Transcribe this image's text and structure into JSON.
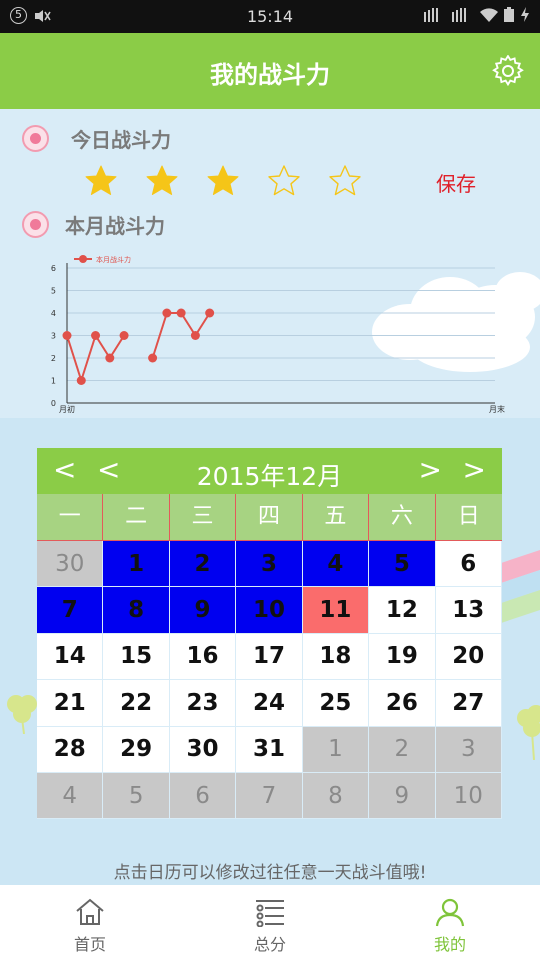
{
  "status_bar": {
    "time": "15:14",
    "badge": "5"
  },
  "header": {
    "title": "我的战斗力"
  },
  "today": {
    "title": "今日战斗力",
    "rating": 3,
    "max": 5,
    "save_label": "保存"
  },
  "month": {
    "title": "本月战斗力"
  },
  "chart_data": {
    "type": "line",
    "series": [
      {
        "name": "本月战斗力",
        "x": [
          1,
          2,
          3,
          4,
          5,
          7,
          8,
          9,
          10,
          11
        ],
        "values": [
          3,
          1,
          3,
          2,
          3,
          2,
          4,
          4,
          3,
          4
        ]
      }
    ],
    "ylim": [
      0,
      6
    ],
    "yticks": [
      "0",
      "1",
      "2",
      "3",
      "4",
      "5",
      "6"
    ],
    "xlabel_start": "月初",
    "xlabel_end": "月末",
    "legend": "top-left",
    "grid": true,
    "color": "#e0514a"
  },
  "calendar": {
    "title": "2015年12月",
    "prev_year": "<",
    "prev_month": "<",
    "next_month": ">",
    "next_year": ">",
    "weekdays": [
      "一",
      "二",
      "三",
      "四",
      "五",
      "六",
      "日"
    ],
    "days": [
      {
        "d": "30",
        "s": "other"
      },
      {
        "d": "1",
        "s": "blue"
      },
      {
        "d": "2",
        "s": "blue"
      },
      {
        "d": "3",
        "s": "blue"
      },
      {
        "d": "4",
        "s": "blue"
      },
      {
        "d": "5",
        "s": "blue"
      },
      {
        "d": "6",
        "s": "normal"
      },
      {
        "d": "7",
        "s": "blue"
      },
      {
        "d": "8",
        "s": "blue"
      },
      {
        "d": "9",
        "s": "blue"
      },
      {
        "d": "10",
        "s": "blue"
      },
      {
        "d": "11",
        "s": "today"
      },
      {
        "d": "12",
        "s": "normal"
      },
      {
        "d": "13",
        "s": "normal"
      },
      {
        "d": "14",
        "s": "normal"
      },
      {
        "d": "15",
        "s": "normal"
      },
      {
        "d": "16",
        "s": "normal"
      },
      {
        "d": "17",
        "s": "normal"
      },
      {
        "d": "18",
        "s": "normal"
      },
      {
        "d": "19",
        "s": "normal"
      },
      {
        "d": "20",
        "s": "normal"
      },
      {
        "d": "21",
        "s": "normal"
      },
      {
        "d": "22",
        "s": "normal"
      },
      {
        "d": "23",
        "s": "normal"
      },
      {
        "d": "24",
        "s": "normal"
      },
      {
        "d": "25",
        "s": "normal"
      },
      {
        "d": "26",
        "s": "normal"
      },
      {
        "d": "27",
        "s": "normal"
      },
      {
        "d": "28",
        "s": "normal"
      },
      {
        "d": "29",
        "s": "normal"
      },
      {
        "d": "30",
        "s": "normal"
      },
      {
        "d": "31",
        "s": "normal"
      },
      {
        "d": "1",
        "s": "other"
      },
      {
        "d": "2",
        "s": "other"
      },
      {
        "d": "3",
        "s": "other"
      },
      {
        "d": "4",
        "s": "other"
      },
      {
        "d": "5",
        "s": "other"
      },
      {
        "d": "6",
        "s": "other"
      },
      {
        "d": "7",
        "s": "other"
      },
      {
        "d": "8",
        "s": "other"
      },
      {
        "d": "9",
        "s": "other"
      },
      {
        "d": "10",
        "s": "other"
      }
    ]
  },
  "hint": "点击日历可以修改过往任意一天战斗值哦!",
  "nav": [
    {
      "label": "首页",
      "icon": "home-icon"
    },
    {
      "label": "总分",
      "icon": "list-icon"
    },
    {
      "label": "我的",
      "icon": "person-icon",
      "active": true
    }
  ],
  "colors": {
    "accent": "#8bcc47",
    "star": "#f5c518",
    "save": "#e0202a",
    "selected_day": "#0000f0",
    "today_day": "#fa6c6c"
  }
}
